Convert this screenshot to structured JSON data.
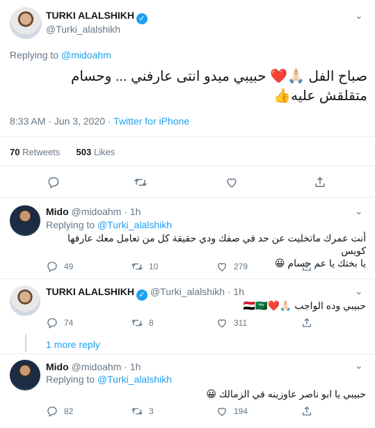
{
  "main_tweet": {
    "author_name": "TURKI ALALSHIKH",
    "author_handle": "@Turki_alalshikh",
    "replying_prefix": "Replying to",
    "replying_to": "@midoahm",
    "text_line1": "صباح الفل 🙏🏻❤️ حبيبي ميدو انتى عارفني ... وحسام",
    "text_line2": "متقلقش عليه👍",
    "time": "8:33 AM · Jun 3, 2020 · ",
    "source": "Twitter for iPhone",
    "retweets_count": "70",
    "retweets_label": "Retweets",
    "likes_count": "503",
    "likes_label": "Likes"
  },
  "replies": [
    {
      "author_name": "Mido",
      "author_handle": "@midoahm · 1h",
      "replying_prefix": "Replying to",
      "replying_to": "@Turki_alalshikh",
      "text_line1": "أنت عمرك ماتخليت عن حد في صفك ودي حقيقة كل من تعامل معك عارفها كويس",
      "text_line2": "يا بختك يا عم حسام 😀",
      "replies": "49",
      "retweets": "10",
      "likes": "279"
    },
    {
      "author_name": "TURKI ALALSHIKH",
      "author_handle": "@Turki_alalshikh · 1h",
      "text_line1": "حبيبي وده الواجب 🙏🏻❤️🇪🇬🇸🇦",
      "replies": "74",
      "retweets": "8",
      "likes": "311"
    },
    {
      "author_name": "Mido",
      "author_handle": "@midoahm · 1h",
      "replying_prefix": "Replying to",
      "replying_to": "@Turki_alalshikh",
      "text_line1": "حبيبي يا ابو ناصر عاوزينه في الزمالك 😀",
      "replies": "82",
      "retweets": "3",
      "likes": "194"
    }
  ],
  "more_replies": "1 more reply",
  "colors": {
    "accent": "#1da1f2",
    "muted": "#657786",
    "divider": "#e6ecf0"
  },
  "icons": [
    "reply-icon",
    "retweet-icon",
    "like-icon",
    "share-icon",
    "verified-icon",
    "chevron-down-icon"
  ]
}
